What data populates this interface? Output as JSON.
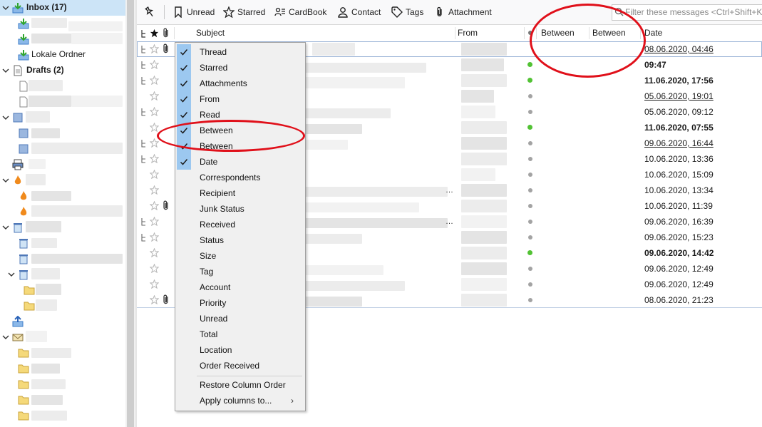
{
  "colors": {
    "unread_dot": "#52c234",
    "read_dot": "#a3a3a3",
    "menu_check_bg": "#9cc8f0",
    "annotation": "#e0101a",
    "selected_row_border": "#9ab3d6"
  },
  "folders": {
    "inbox": {
      "label": "Inbox (17)",
      "icon": "inbox-download-icon"
    },
    "local": {
      "label": "Lokale Ordner",
      "icon": "inbox-download-icon"
    },
    "drafts": {
      "label": "Drafts (2)",
      "icon": "drafts-icon"
    }
  },
  "toolbar": {
    "pin_icon": "pin-icon",
    "buttons": [
      {
        "label": "Unread",
        "icon": "bookmark-icon"
      },
      {
        "label": "Starred",
        "icon": "star-icon"
      },
      {
        "label": "CardBook",
        "icon": "cardbook-icon"
      },
      {
        "label": "Contact",
        "icon": "contact-icon"
      },
      {
        "label": "Tags",
        "icon": "tag-icon"
      },
      {
        "label": "Attachment",
        "icon": "paperclip-icon"
      }
    ],
    "filter_placeholder": "Filter these messages <Ctrl+Shift+K>"
  },
  "columns": {
    "subject": "Subject",
    "from": "From",
    "between1": "Between",
    "between2": "Between",
    "date": "Date"
  },
  "messages": [
    {
      "date": "08.06.2020, 04:46",
      "bold": false,
      "underline": true,
      "unread_dot": false,
      "dot": false,
      "attachment": true,
      "thread": true
    },
    {
      "date": "09:47",
      "bold": true,
      "underline": false,
      "unread_dot": true,
      "dot": true,
      "attachment": false,
      "thread": true
    },
    {
      "date": "11.06.2020, 17:56",
      "bold": true,
      "underline": false,
      "unread_dot": true,
      "dot": true,
      "attachment": false,
      "thread": true
    },
    {
      "date": "05.06.2020, 19:01",
      "bold": false,
      "underline": true,
      "unread_dot": false,
      "dot": true,
      "attachment": false,
      "thread": false
    },
    {
      "date": "05.06.2020, 09:12",
      "bold": false,
      "underline": false,
      "unread_dot": false,
      "dot": true,
      "attachment": false,
      "thread": true
    },
    {
      "date": "11.06.2020, 07:55",
      "bold": true,
      "underline": false,
      "unread_dot": true,
      "dot": true,
      "attachment": false,
      "thread": false
    },
    {
      "date": "09.06.2020, 16:44",
      "bold": false,
      "underline": true,
      "unread_dot": false,
      "dot": true,
      "attachment": false,
      "thread": true
    },
    {
      "date": "10.06.2020, 13:36",
      "bold": false,
      "underline": false,
      "unread_dot": false,
      "dot": true,
      "attachment": false,
      "thread": true
    },
    {
      "date": "10.06.2020, 15:09",
      "bold": false,
      "underline": false,
      "unread_dot": false,
      "dot": true,
      "attachment": false,
      "thread": false
    },
    {
      "date": "10.06.2020, 13:34",
      "bold": false,
      "underline": false,
      "unread_dot": false,
      "dot": true,
      "attachment": false,
      "thread": false
    },
    {
      "date": "10.06.2020, 11:39",
      "bold": false,
      "underline": false,
      "unread_dot": false,
      "dot": true,
      "attachment": true,
      "thread": false
    },
    {
      "date": "09.06.2020, 16:39",
      "bold": false,
      "underline": false,
      "unread_dot": false,
      "dot": true,
      "attachment": false,
      "thread": true
    },
    {
      "date": "09.06.2020, 15:23",
      "bold": false,
      "underline": false,
      "unread_dot": false,
      "dot": true,
      "attachment": false,
      "thread": true
    },
    {
      "date": "09.06.2020, 14:42",
      "bold": true,
      "underline": false,
      "unread_dot": true,
      "dot": true,
      "attachment": false,
      "thread": false
    },
    {
      "date": "09.06.2020, 12:49",
      "bold": false,
      "underline": false,
      "unread_dot": false,
      "dot": true,
      "attachment": false,
      "thread": false
    },
    {
      "date": "09.06.2020, 12:49",
      "bold": false,
      "underline": false,
      "unread_dot": false,
      "dot": true,
      "attachment": false,
      "thread": false
    },
    {
      "date": "08.06.2020, 21:23",
      "bold": false,
      "underline": false,
      "unread_dot": false,
      "dot": true,
      "attachment": true,
      "thread": false
    }
  ],
  "column_menu": {
    "items": [
      {
        "label": "Thread",
        "checked": true
      },
      {
        "label": "Starred",
        "checked": true
      },
      {
        "label": "Attachments",
        "checked": true
      },
      {
        "label": "From",
        "checked": true
      },
      {
        "label": "Read",
        "checked": true
      },
      {
        "label": "Between",
        "checked": true
      },
      {
        "label": "Between",
        "checked": true
      },
      {
        "label": "Date",
        "checked": true
      },
      {
        "label": "Correspondents",
        "checked": false
      },
      {
        "label": "Recipient",
        "checked": false
      },
      {
        "label": "Junk Status",
        "checked": false
      },
      {
        "label": "Received",
        "checked": false
      },
      {
        "label": "Status",
        "checked": false
      },
      {
        "label": "Size",
        "checked": false
      },
      {
        "label": "Tag",
        "checked": false
      },
      {
        "label": "Account",
        "checked": false
      },
      {
        "label": "Priority",
        "checked": false
      },
      {
        "label": "Unread",
        "checked": false
      },
      {
        "label": "Total",
        "checked": false
      },
      {
        "label": "Location",
        "checked": false
      },
      {
        "label": "Order Received",
        "checked": false
      }
    ],
    "footer": [
      {
        "label": "Restore Column Order",
        "submenu": false
      },
      {
        "label": "Apply columns to...",
        "submenu": true,
        "arrow": "›"
      }
    ]
  }
}
